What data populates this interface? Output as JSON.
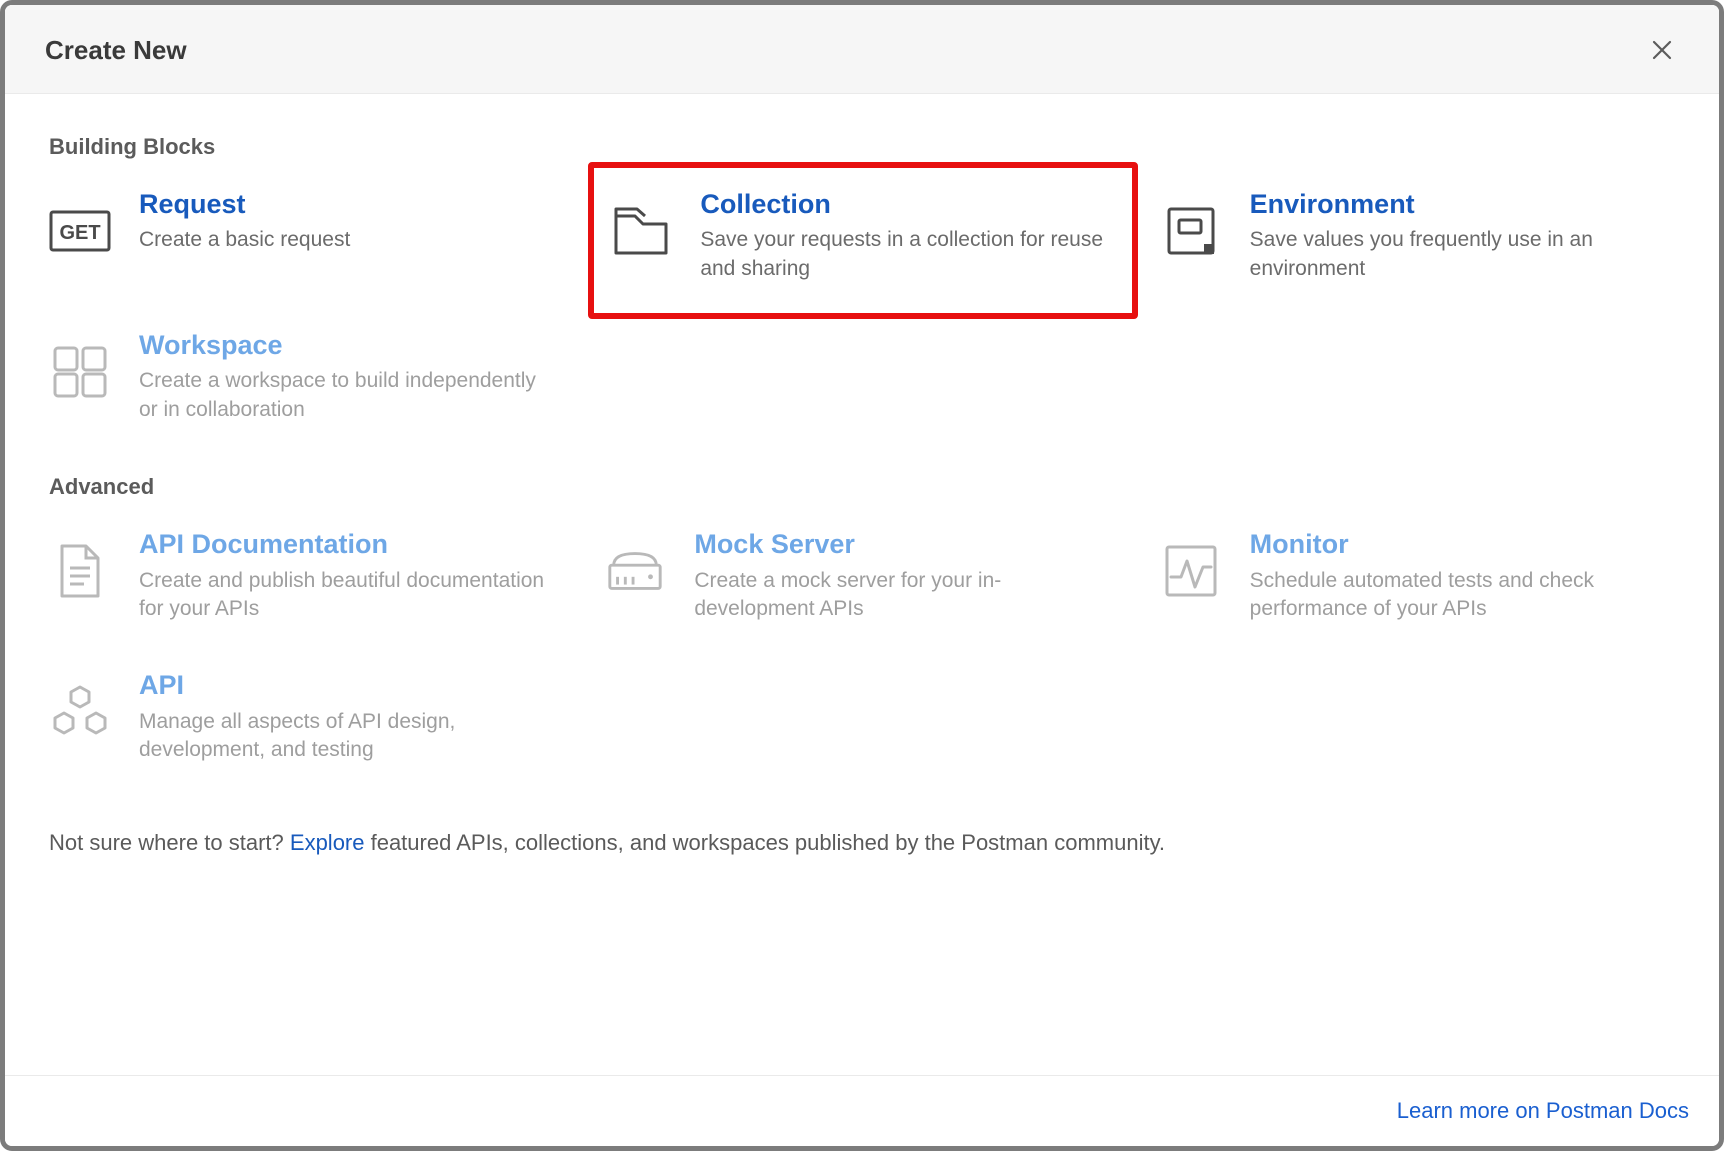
{
  "dialog_title": "Create New",
  "sections": {
    "building_blocks": {
      "heading": "Building Blocks",
      "tiles": {
        "request": {
          "title": "Request",
          "desc": "Create a basic request"
        },
        "collection": {
          "title": "Collection",
          "desc": "Save your requests in a collection for reuse and sharing"
        },
        "environment": {
          "title": "Environment",
          "desc": "Save values you frequently use in an environment"
        },
        "workspace": {
          "title": "Workspace",
          "desc": "Create a workspace to build independently or in collaboration"
        }
      }
    },
    "advanced": {
      "heading": "Advanced",
      "tiles": {
        "api_docs": {
          "title": "API Documentation",
          "desc": "Create and publish beautiful documentation for your APIs"
        },
        "mock_server": {
          "title": "Mock Server",
          "desc": "Create a mock server for your in-development APIs"
        },
        "monitor": {
          "title": "Monitor",
          "desc": "Schedule automated tests and check performance of your APIs"
        },
        "api": {
          "title": "API",
          "desc": "Manage all aspects of API design, development, and testing"
        }
      }
    }
  },
  "footer": {
    "pre": "Not sure where to start? ",
    "link": "Explore",
    "post": " featured APIs, collections, and workspaces published by the Postman community."
  },
  "docs_link": "Learn more on Postman Docs"
}
